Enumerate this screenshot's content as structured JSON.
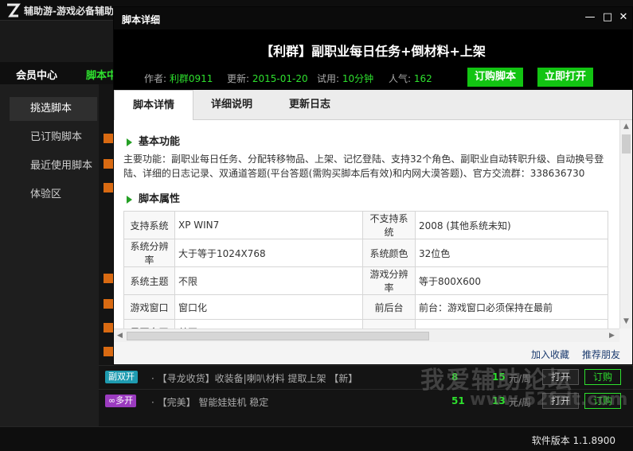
{
  "app": {
    "title": "辅助游-游戏必备辅助工具",
    "nav": {
      "member": "会员中心",
      "scripts": "脚本中心"
    },
    "sidebar": [
      "挑选脚本",
      "已订购脚本",
      "最近使用脚本",
      "体验区"
    ],
    "rows": [
      {
        "tag": "副双开",
        "tag_color": "#1e9bb0",
        "title": "· 【寻龙收货】收装备|喇叭材料 提取上架 【新】",
        "n1": "8",
        "n2": "15",
        "unit": "元/周",
        "open": "打开",
        "buy": "订购"
      },
      {
        "tag": "∞多开",
        "tag_color": "#9b3bbf",
        "title": "· 【完美】 智能娃娃机 稳定",
        "n1": "51",
        "n2": "13",
        "unit": "元/周",
        "open": "打开",
        "buy": "订购"
      }
    ],
    "version_label": "软件版本 1.1.8900",
    "watermark": "我爱辅助论坛",
    "watermark_url": "www.52fzlt.com"
  },
  "dialog": {
    "title": "脚本详细",
    "script_title": "【利群】副职业每日任务+倒材料+上架",
    "meta": {
      "author_label": "作者:",
      "author": "利群0911",
      "updated_label": "更新:",
      "updated": "2015-01-20",
      "trial_label": "试用:",
      "trial": "10分钟",
      "popularity_label": "人气:",
      "popularity": "162"
    },
    "buttons": {
      "subscribe": "订购脚本",
      "open": "立即打开"
    },
    "tabs": [
      "脚本详情",
      "详细说明",
      "更新日志"
    ],
    "sections": {
      "basic_title": "基本功能",
      "basic_text": "主要功能：副职业每日任务、分配转移物品、上架、记忆登陆、支持32个角色、副职业自动转职升级、自动换号登陆、详细的日志记录、双通道答题(平台答题(需购买脚本后有效)和内网大漠答题)、官方交流群：338636730",
      "props_title": "脚本属性"
    },
    "props": [
      [
        "支持系统",
        "XP WIN7",
        "不支持系统",
        "2008 (其他系统未知)"
      ],
      [
        "系统分辨率",
        "大于等于1024X768",
        "系统颜色",
        "32位色"
      ],
      [
        "系统主题",
        "不限",
        "游戏分辨率",
        "等于800X600"
      ],
      [
        "游戏窗口",
        "窗口化",
        "前后台",
        "前台：游戏窗口必须保持在最前"
      ],
      [
        "是否多开",
        "单开",
        "",
        ""
      ]
    ],
    "footer": {
      "favorite": "加入收藏",
      "recommend": "推荐朋友"
    }
  }
}
